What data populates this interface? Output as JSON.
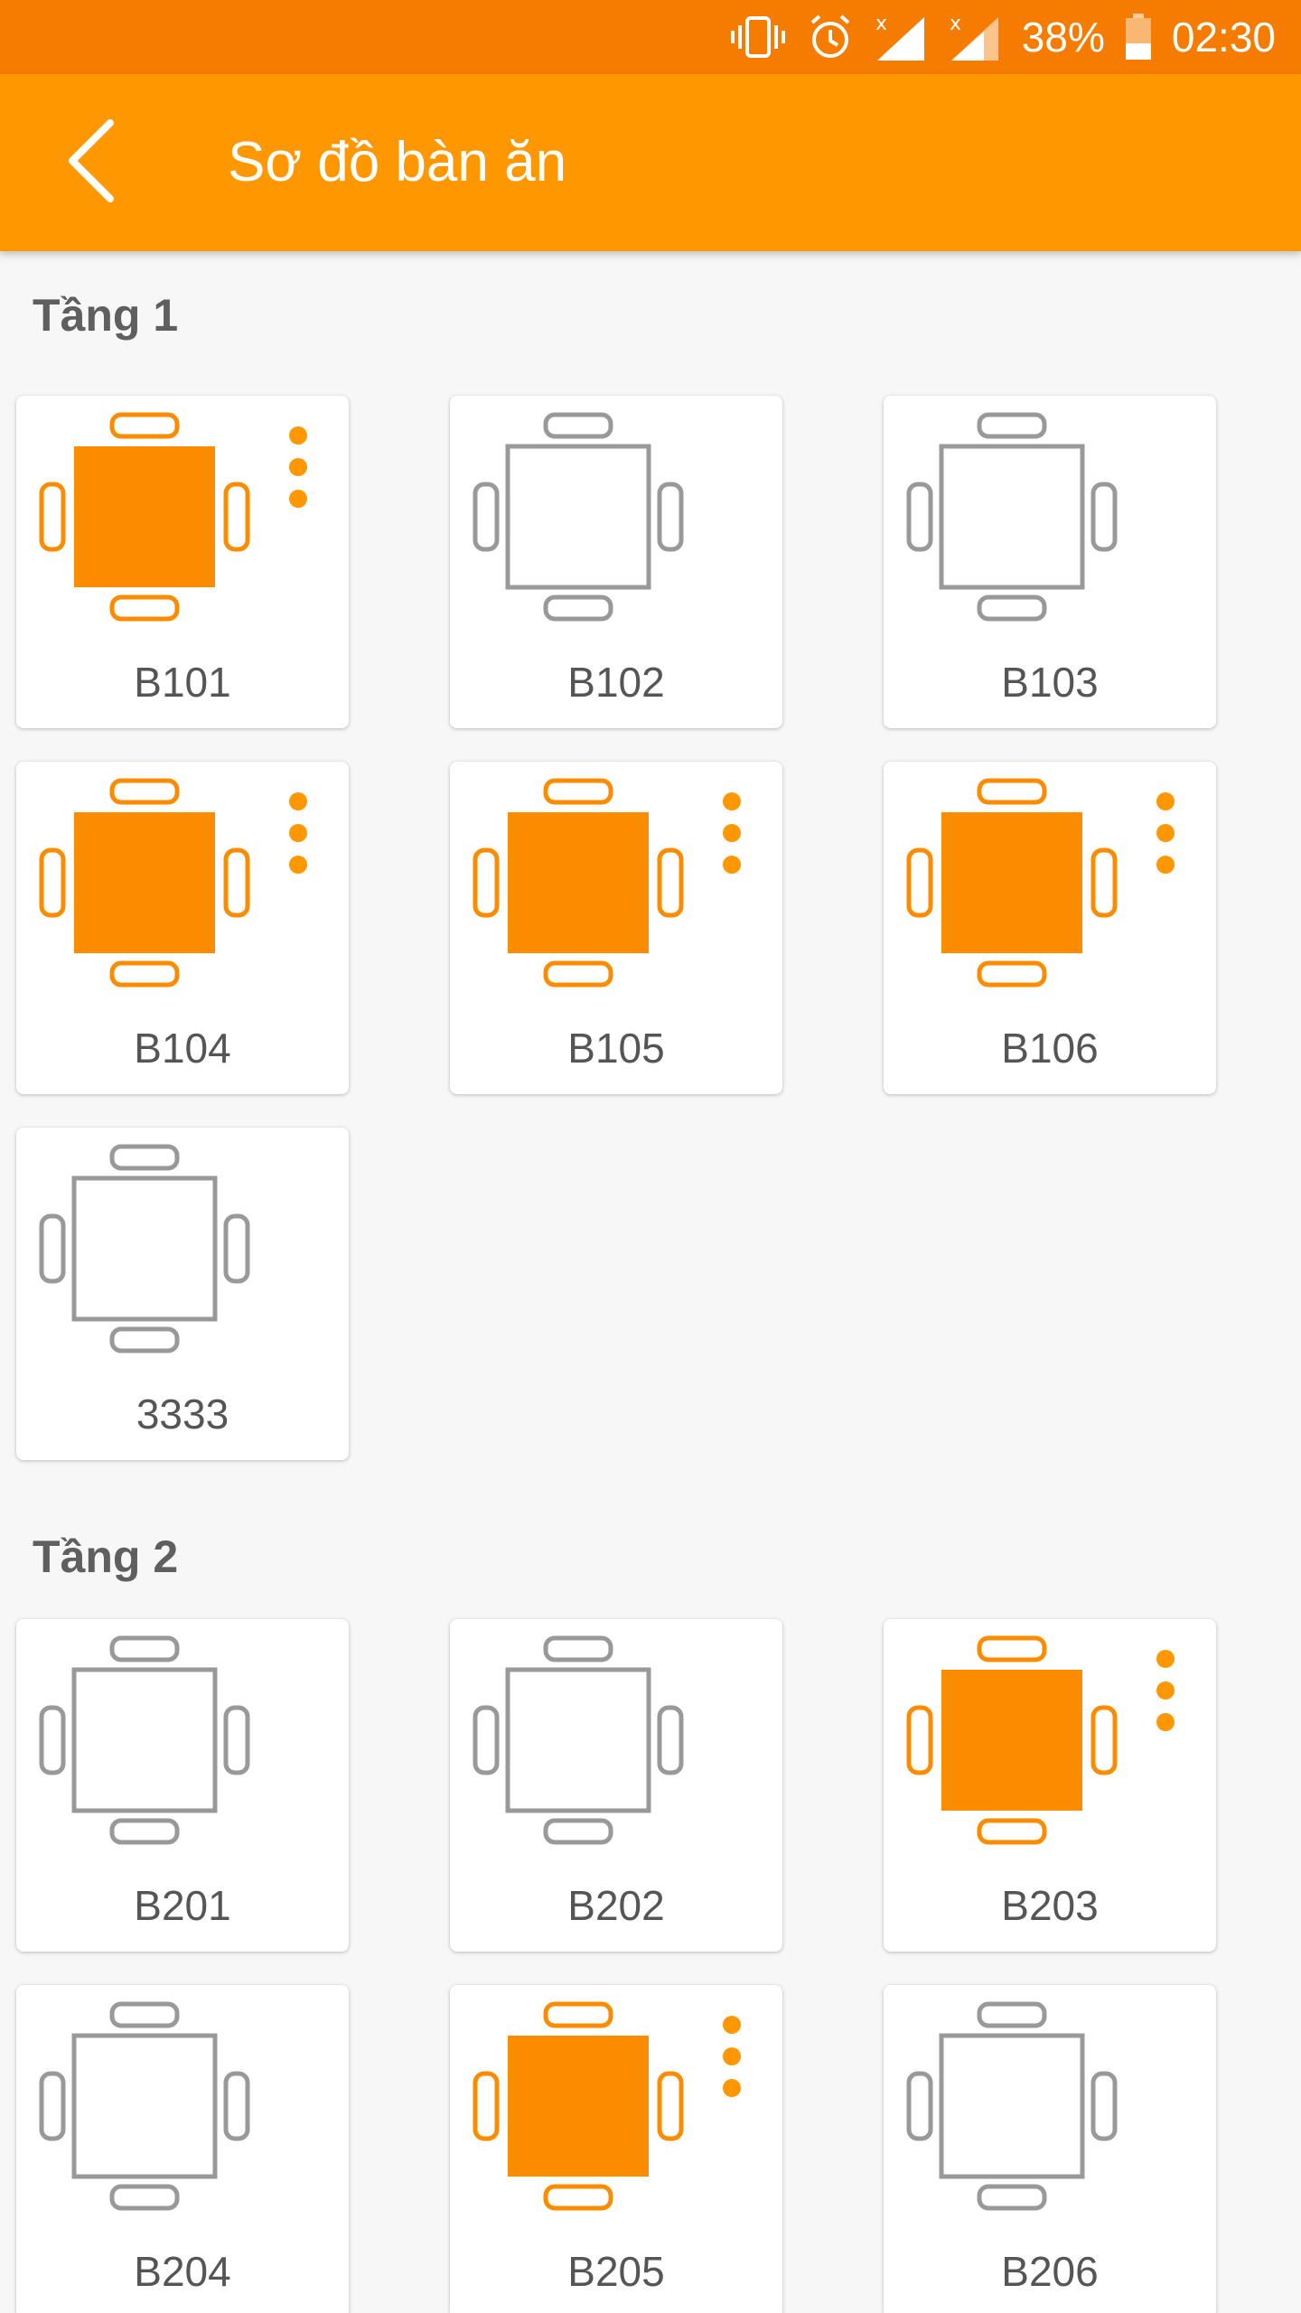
{
  "status_bar": {
    "battery_percent": "38%",
    "time": "02:30",
    "icons": [
      "vibrate-icon",
      "alarm-icon",
      "signal-icon",
      "signal-icon",
      "battery-icon"
    ]
  },
  "app_bar": {
    "title": "Sơ đồ bàn ăn",
    "back_icon": "chevron-left-icon"
  },
  "colors": {
    "status_bar": "#f57c00",
    "app_bar": "#ff9800",
    "occupied": "#fb8c00",
    "dots": "#ff9800",
    "empty": "#999999"
  },
  "floors": [
    {
      "name": "Tầng 1",
      "tables": [
        {
          "label": "B101",
          "occupied": true
        },
        {
          "label": "B102",
          "occupied": false
        },
        {
          "label": "B103",
          "occupied": false
        },
        {
          "label": "B104",
          "occupied": true
        },
        {
          "label": "B105",
          "occupied": true
        },
        {
          "label": "B106",
          "occupied": true
        },
        {
          "label": "3333",
          "occupied": false
        }
      ]
    },
    {
      "name": "Tầng 2",
      "tables": [
        {
          "label": "B201",
          "occupied": false
        },
        {
          "label": "B202",
          "occupied": false
        },
        {
          "label": "B203",
          "occupied": true
        },
        {
          "label": "B204",
          "occupied": false
        },
        {
          "label": "B205",
          "occupied": true
        },
        {
          "label": "B206",
          "occupied": false
        }
      ]
    }
  ]
}
